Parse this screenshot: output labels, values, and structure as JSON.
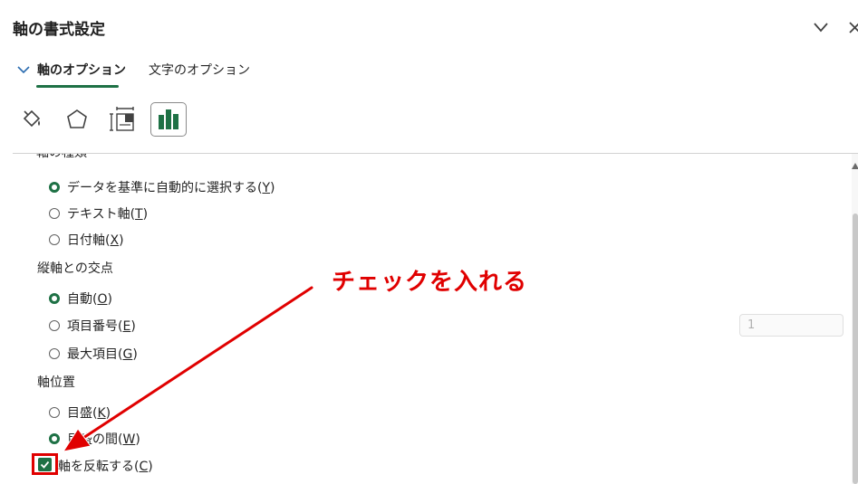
{
  "pane": {
    "title": "軸の書式設定"
  },
  "tabs": [
    {
      "label": "軸のオプション",
      "active": true
    },
    {
      "label": "文字のオプション",
      "active": false
    }
  ],
  "category_icons": [
    "fill-bucket-icon",
    "pentagon-effects-icon",
    "size-properties-icon",
    "bar-chart-icon"
  ],
  "axis_type": {
    "clipped_label": "軸の種類",
    "options": [
      {
        "label": "データを基準に自動的に選択する(",
        "key": "Y",
        "suffix": ")",
        "checked": true
      },
      {
        "label": "テキスト軸(",
        "key": "T",
        "suffix": ")",
        "checked": false
      },
      {
        "label": "日付軸(",
        "key": "X",
        "suffix": ")",
        "checked": false
      }
    ]
  },
  "crosses": {
    "label": "縦軸との交点",
    "options": [
      {
        "label": "自動(",
        "key": "O",
        "suffix": ")",
        "checked": true
      },
      {
        "label": "項目番号(",
        "key": "E",
        "suffix": ")",
        "checked": false
      },
      {
        "label": "最大項目(",
        "key": "G",
        "suffix": ")",
        "checked": false
      }
    ],
    "category_number_value": "1"
  },
  "axis_position": {
    "label": "軸位置",
    "options": [
      {
        "label": "目盛(",
        "key": "K",
        "suffix": ")",
        "checked": false
      },
      {
        "label": "目盛の間(",
        "key": "W",
        "suffix": ")",
        "checked": true
      }
    ]
  },
  "reverse": {
    "label": "軸を反転する(",
    "key": "C",
    "suffix": ")",
    "checked": true
  },
  "annotation": {
    "text": "チェックを入れる",
    "color": "#e00000"
  },
  "colors": {
    "accent": "#1e7145",
    "highlight": "#e00000"
  }
}
